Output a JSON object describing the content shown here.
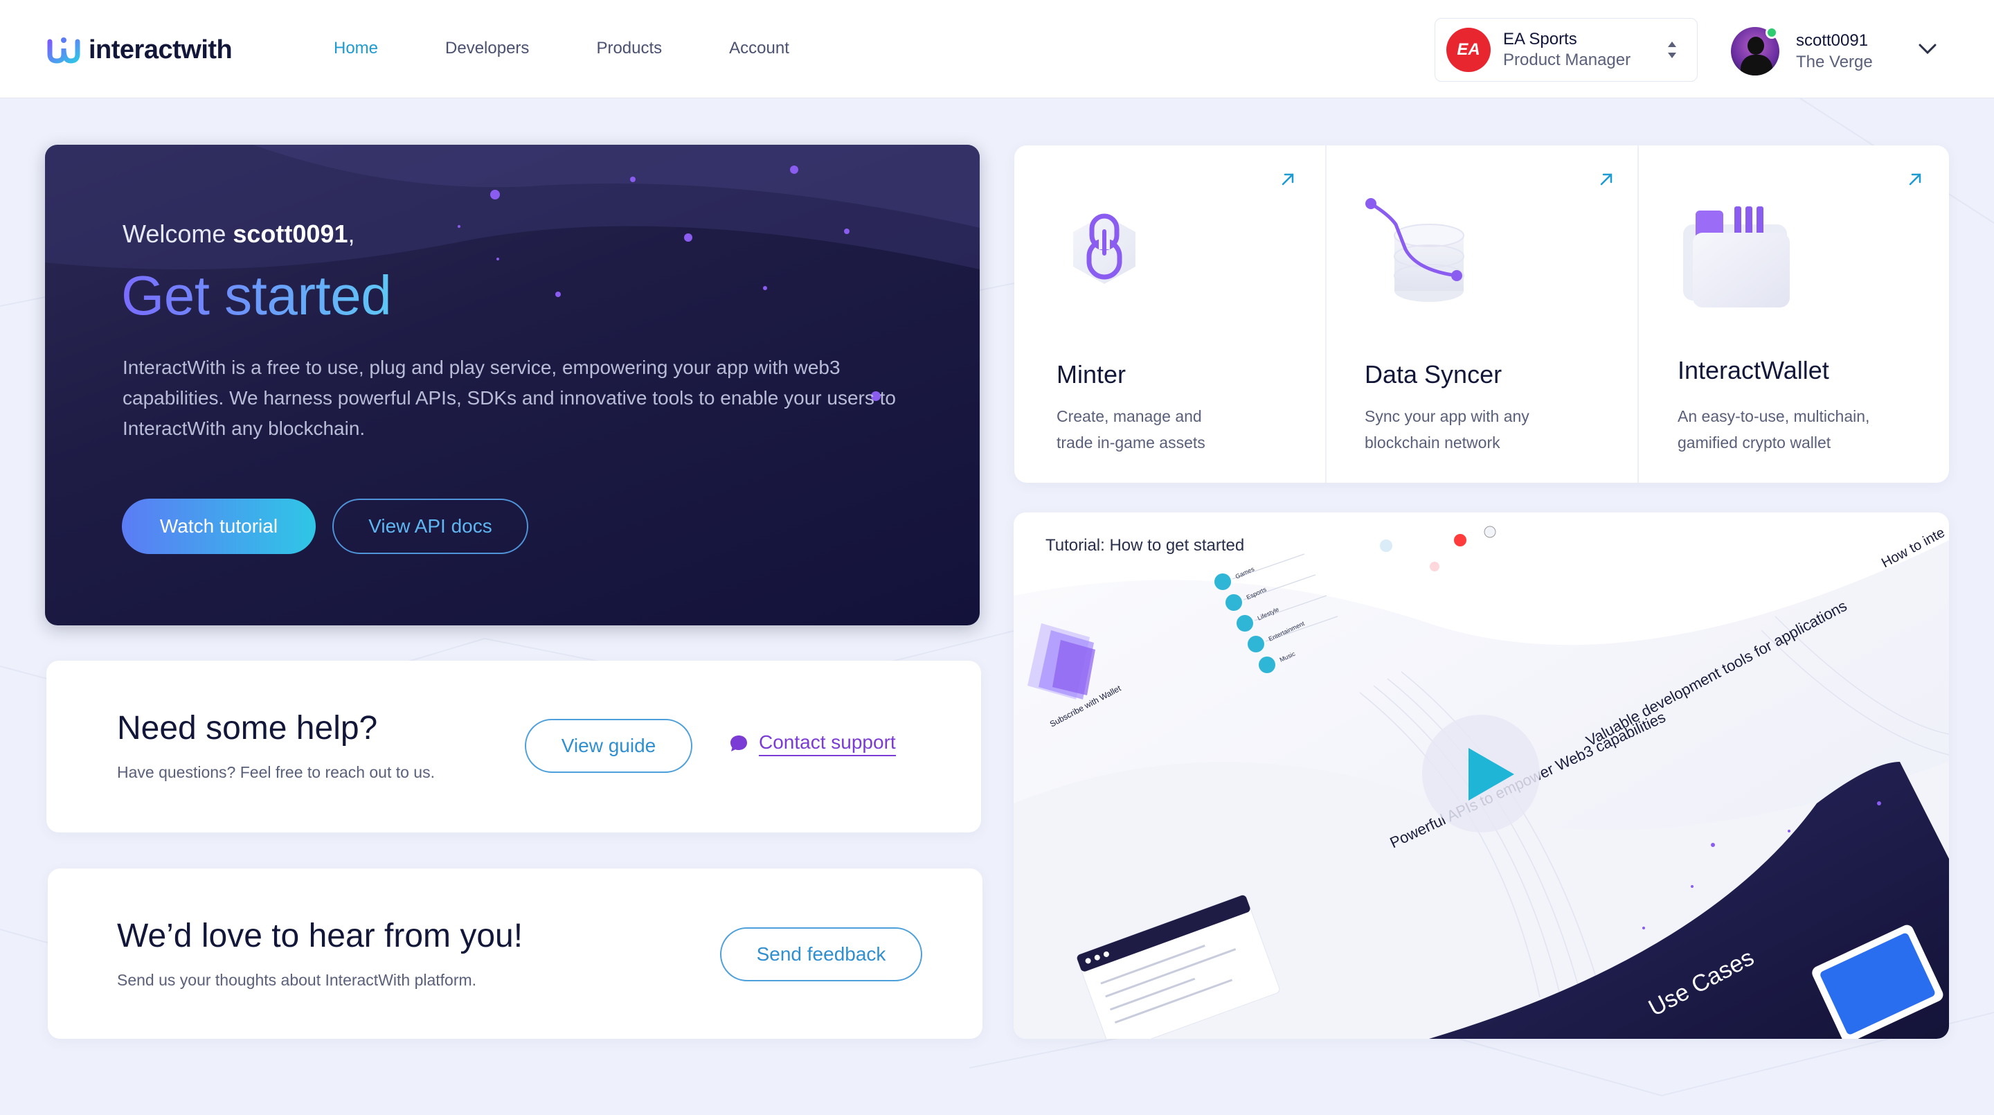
{
  "brand": {
    "name": "interactwith"
  },
  "nav": [
    {
      "label": "Home",
      "active": true
    },
    {
      "label": "Developers",
      "active": false
    },
    {
      "label": "Products",
      "active": false
    },
    {
      "label": "Account",
      "active": false
    }
  ],
  "org": {
    "badge": "EA",
    "name": "EA Sports",
    "role": "Product Manager"
  },
  "user": {
    "name": "scott0091",
    "org": "The Verge",
    "status": "online"
  },
  "hero": {
    "welcome_prefix": "Welcome ",
    "username": "scott0091",
    "welcome_suffix": ",",
    "title": "Get started",
    "description": "InteractWith is a free to use, plug and play service, empowering your app with web3 capabilities. We harness powerful APIs, SDKs and innovative tools to enable your users to InteractWith any blockchain.",
    "primary_button": "Watch tutorial",
    "secondary_button": "View API docs"
  },
  "help": {
    "title": "Need some help?",
    "subtitle": "Have questions? Feel free to reach out to us.",
    "guide_button": "View guide",
    "support_link": "Contact support"
  },
  "feedback": {
    "title": "We’d love to hear from you!",
    "subtitle": "Send us your thoughts about InteractWith platform.",
    "button": "Send feedback"
  },
  "products": [
    {
      "title": "Minter",
      "description": "Create, manage and trade in-game assets",
      "icon": "chain-link-icon"
    },
    {
      "title": "Data Syncer",
      "description": "Sync your app with any blockchain network",
      "icon": "database-sync-icon"
    },
    {
      "title": "InteractWallet",
      "description": "An easy-to-use, multichain, gamified crypto wallet",
      "icon": "wallet-icon"
    }
  ],
  "tutorial": {
    "label": "Tutorial: How to get started",
    "preview_headings": [
      "Powerful APIs to empower Web3 capabilities",
      "Valuable development tools for applications",
      "Use Cases",
      "How to inte",
      "Subscribe with Wallet"
    ],
    "preview_categories": [
      "Games",
      "Esports",
      "Lifestyle",
      "Entertainment",
      "Music"
    ]
  },
  "colors": {
    "accent_blue": "#1e9bd0",
    "accent_purple": "#7b3cd6",
    "hero_bg": "#1e1c45",
    "page_bg": "#eef1fb"
  }
}
